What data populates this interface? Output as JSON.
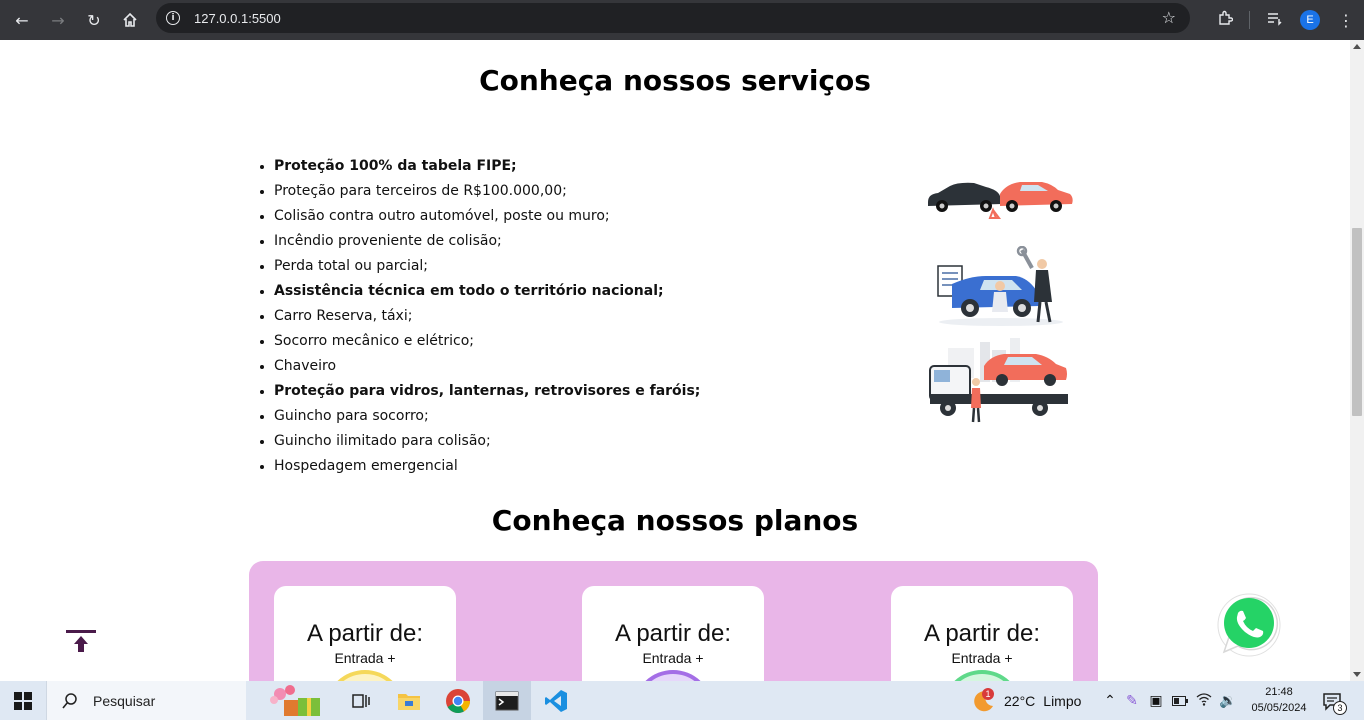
{
  "browser": {
    "url": "127.0.0.1:5500",
    "profile_initial": "E"
  },
  "services": {
    "title": "Conheça nossos serviços",
    "items": [
      {
        "text": "Proteção 100% da tabela FIPE;",
        "bold": true
      },
      {
        "text": "Proteção para terceiros de R$100.000,00;",
        "bold": false
      },
      {
        "text": "Colisão contra outro automóvel, poste ou muro;",
        "bold": false
      },
      {
        "text": "Incêndio proveniente de colisão;",
        "bold": false
      },
      {
        "text": "Perda total ou parcial;",
        "bold": false
      },
      {
        "text": "Assistência técnica em todo o território nacional;",
        "bold": true
      },
      {
        "text": "Carro Reserva, táxi;",
        "bold": false
      },
      {
        "text": "Socorro mecânico e elétrico;",
        "bold": false
      },
      {
        "text": "Chaveiro",
        "bold": false
      },
      {
        "text": "Proteção para vidros, lanternas, retrovisores e faróis;",
        "bold": true
      },
      {
        "text": "Guincho para socorro;",
        "bold": false
      },
      {
        "text": "Guincho ilimitado para colisão;",
        "bold": false
      },
      {
        "text": "Hospedagem emergencial",
        "bold": false
      }
    ]
  },
  "plans": {
    "title": "Conheça nossos planos",
    "cards": [
      {
        "prefix": "A partir de:",
        "entrada": "Entrada +",
        "accent": "#f5d85a"
      },
      {
        "prefix": "A partir de:",
        "entrada": "Entrada +",
        "accent": "#a46ee6"
      },
      {
        "prefix": "A partir de:",
        "entrada": "Entrada +",
        "accent": "#5fd98a"
      }
    ]
  },
  "taskbar": {
    "search_label": "Pesquisar",
    "weather_temp": "22°C",
    "weather_desc": "Limpo",
    "weather_badge": "1",
    "time": "21:48",
    "date": "05/05/2024",
    "notifications": "3"
  },
  "colors": {
    "plans_bg": "#e9b6e8",
    "whatsapp": "#25d366",
    "back_to_top": "#4a1a4a"
  }
}
